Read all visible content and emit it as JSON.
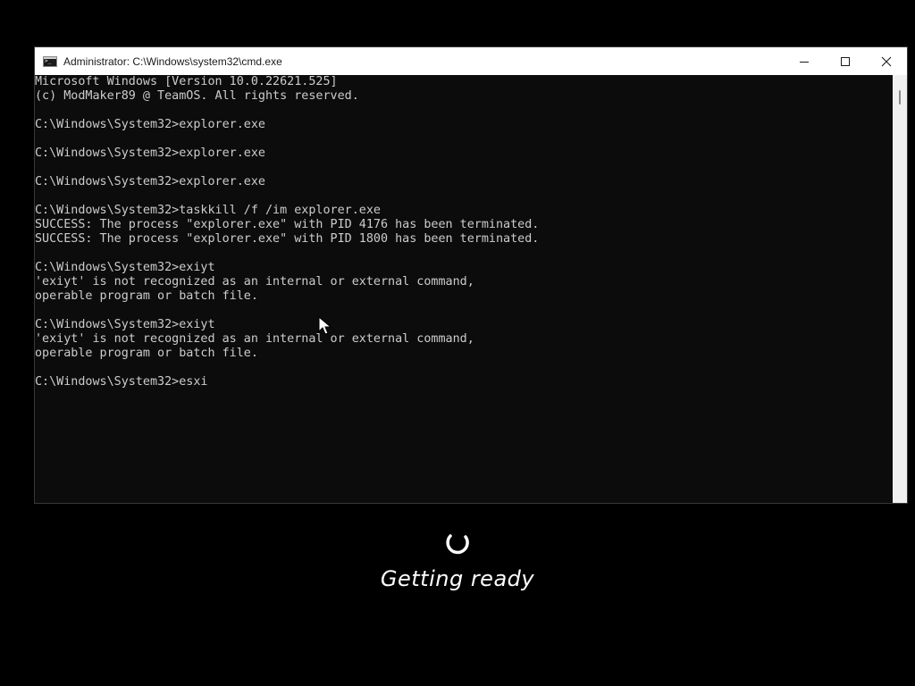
{
  "window": {
    "title": "Administrator: C:\\Windows\\system32\\cmd.exe",
    "minimize_label": "Minimize",
    "maximize_label": "Maximize",
    "close_label": "Close"
  },
  "console": {
    "lines": [
      "Microsoft Windows [Version 10.0.22621.525]",
      "(c) ModMaker89 @ TeamOS. All rights reserved.",
      "",
      "C:\\Windows\\System32>explorer.exe",
      "",
      "C:\\Windows\\System32>explorer.exe",
      "",
      "C:\\Windows\\System32>explorer.exe",
      "",
      "C:\\Windows\\System32>taskkill /f /im explorer.exe",
      "SUCCESS: The process \"explorer.exe\" with PID 4176 has been terminated.",
      "SUCCESS: The process \"explorer.exe\" with PID 1800 has been terminated.",
      "",
      "C:\\Windows\\System32>exiyt",
      "'exiyt' is not recognized as an internal or external command,",
      "operable program or batch file.",
      "",
      "C:\\Windows\\System32>exiyt",
      "'exiyt' is not recognized as an internal or external command,",
      "operable program or batch file.",
      "",
      "C:\\Windows\\System32>esxi"
    ]
  },
  "loading": {
    "status_text": "Getting ready"
  },
  "icons": {
    "app": "cmd-icon",
    "minimize": "minimize-icon",
    "maximize": "maximize-icon",
    "close": "close-icon",
    "spinner": "spinner-icon",
    "cursor": "mouse-pointer-icon"
  },
  "colors": {
    "console_bg": "#0c0c0c",
    "console_text": "#cccccc",
    "titlebar_bg": "#ffffff",
    "desktop_bg": "#000000"
  }
}
